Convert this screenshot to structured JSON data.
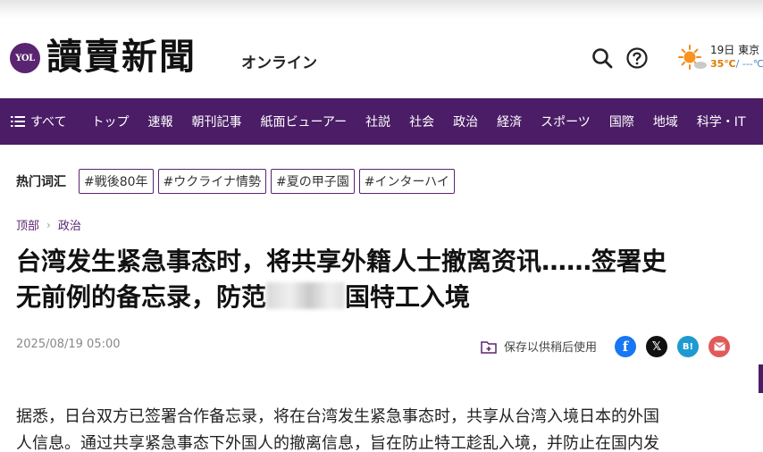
{
  "header": {
    "logo_mark": "YOL",
    "logo_title": "讀賣新聞",
    "logo_subtitle": "オンライン",
    "weather_date": "19日 東京",
    "weather_high": "35℃",
    "weather_low": "/ ---℃"
  },
  "nav": {
    "all_label": "すべて",
    "items": [
      "トップ",
      "速報",
      "朝刊記事",
      "紙面ビューアー",
      "社説",
      "社会",
      "政治",
      "経済",
      "スポーツ",
      "国際",
      "地域",
      "科学・IT"
    ]
  },
  "hot_topics": {
    "label": "热门词汇",
    "tags": [
      "#戦後80年",
      "#ウクライナ情勢",
      "#夏の甲子園",
      "#インターハイ"
    ]
  },
  "breadcrumb": {
    "home": "顶部",
    "section": "政治"
  },
  "article": {
    "headline_line1": "台湾发生紧急事态时，将共享外籍人士撤离资讯……签署史",
    "headline_line2_a": "无前例的备忘录，防范",
    "headline_line2_b": "国特工入境",
    "date": "2025/08/19 05:00",
    "save_label": "保存以供稍后使用",
    "body_line1": "据悉，日台双方已签署合作备忘录，将在台湾发生紧急事态时，共享从台湾入境日本的外国",
    "body_line2": "人信息。通过共享紧急事态下外国人的撤离信息，旨在防止特工趁乱入境，并防止在国内发"
  },
  "share": {
    "facebook": "f",
    "x": "𝕏",
    "hatena": "B!"
  },
  "colors": {
    "brand": "#4b1d66",
    "accent_orange": "#e07a00"
  },
  "icons": [
    "search-icon",
    "help-icon",
    "weather-sun-icon",
    "menu-icon",
    "bookmark-folder-icon",
    "mail-icon"
  ]
}
